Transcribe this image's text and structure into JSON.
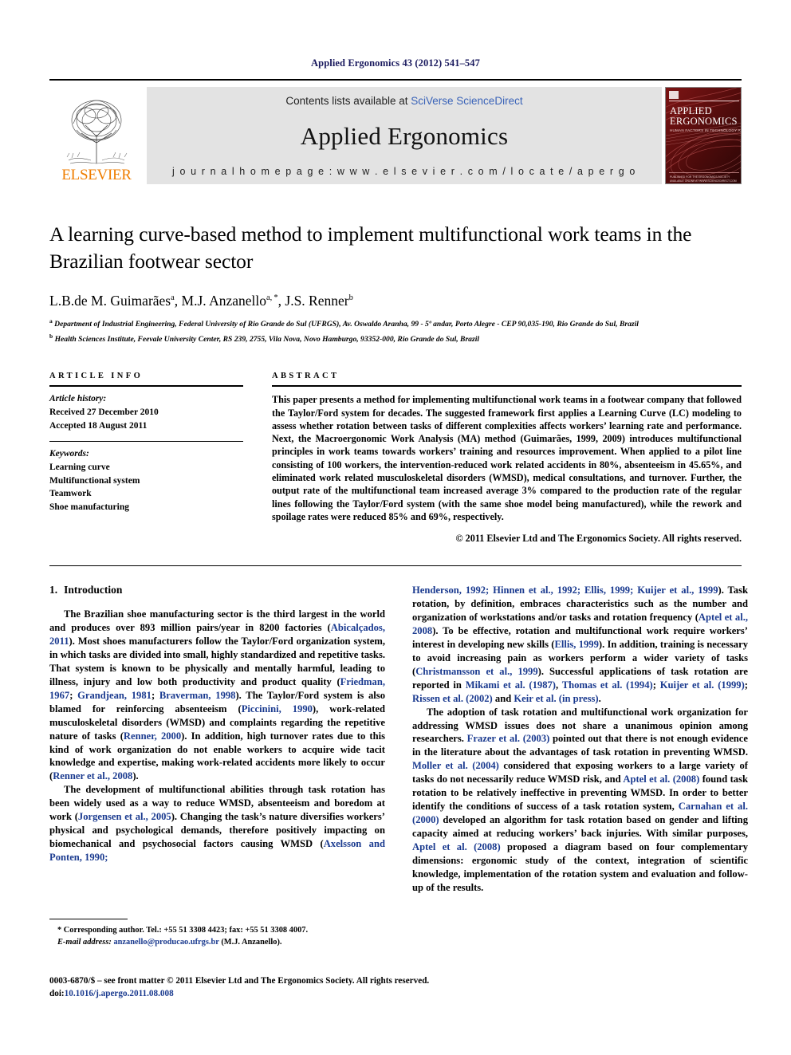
{
  "running_head": "Applied Ergonomics 43 (2012) 541–547",
  "masthead": {
    "publisher_logo_text": "ELSEVIER",
    "contents_prefix": "Contents lists available at ",
    "contents_link": "SciVerse ScienceDirect",
    "journal_name": "Applied Ergonomics",
    "homepage_label": "j o u r n a l   h o m e p a g e :   w w w . e l s e v i e r . c o m / l o c a t e / a p e r g o",
    "cover": {
      "line1": "APPLIED",
      "line2": "ERGONOMICS",
      "line3": "HUMAN FACTORS IN TECHNOLOGY AND SOCIETY"
    }
  },
  "article": {
    "title": "A learning curve-based method to implement multifunctional work teams in the Brazilian footwear sector",
    "authors": "L.B.de M. Guimarães<sup>a</sup>, M.J. Anzanello<sup>a, *</sup>, J.S. Renner<sup>b</sup>",
    "affiliation_a": "<sup>a</sup> Department of Industrial Engineering, Federal University of Rio Grande do Sul (UFRGS), Av. Oswaldo Aranha, 99 - 5º andar, Porto Alegre - CEP 90,035-190, Rio Grande do Sul, Brazil",
    "affiliation_b": "<sup>b</sup> Health Sciences Institute, Feevale University Center, RS 239, 2755, Vila Nova, Novo Hamburgo, 93352-000, Rio Grande do Sul, Brazil"
  },
  "info": {
    "heading": "ARTICLE INFO",
    "history_label": "Article history:",
    "history_lines": [
      "Received 27 December 2010",
      "Accepted 18 August 2011"
    ],
    "keywords_label": "Keywords:",
    "keywords": [
      "Learning curve",
      "Multifunctional system",
      "Teamwork",
      "Shoe manufacturing"
    ]
  },
  "abstract": {
    "heading": "ABSTRACT",
    "text": "This paper presents a method for implementing multifunctional work teams in a footwear company that followed the Taylor/Ford system for decades. The suggested framework first applies a Learning Curve (LC) modeling to assess whether rotation between tasks of different complexities affects workers’ learning rate and performance. Next, the Macroergonomic Work Analysis (MA) method (Guimarães, 1999, 2009) introduces multifunctional principles in work teams towards workers’ training and resources improvement. When applied to a pilot line consisting of 100 workers, the intervention-reduced work related accidents in 80%, absenteeism in 45.65%, and eliminated work related musculoskeletal disorders (WMSD), medical consultations, and turnover. Further, the output rate of the multifunctional team increased average 3% compared to the production rate of the regular lines following the Taylor/Ford system (with the same shoe model being manufactured), while the rework and spoilage rates were reduced 85% and 69%, respectively.",
    "copyright": "© 2011 Elsevier Ltd and The Ergonomics Society. All rights reserved."
  },
  "body": {
    "section_number": "1.",
    "section_title": "Introduction",
    "left_paragraphs": [
      "The Brazilian shoe manufacturing sector is the third largest in the world and produces over 893 million pairs/year in 8200 factories (<a class=\"ref\" data-name=\"citation-link\" data-interactable=\"true\">Abicalçados, 2011</a>). Most shoes manufacturers follow the Taylor/Ford organization system, in which tasks are divided into small, highly standardized and repetitive tasks. That system is known to be physically and mentally harmful, leading to illness, injury and low both productivity and product quality (<a class=\"ref\" data-name=\"citation-link\" data-interactable=\"true\">Friedman, 1967</a>; <a class=\"ref\" data-name=\"citation-link\" data-interactable=\"true\">Grandjean, 1981</a>; <a class=\"ref\" data-name=\"citation-link\" data-interactable=\"true\">Braverman, 1998</a>). The Taylor/Ford system is also blamed for reinforcing absenteeism (<a class=\"ref\" data-name=\"citation-link\" data-interactable=\"true\">Piccinini, 1990</a>), work-related musculoskeletal disorders (WMSD) and complaints regarding the repetitive nature of tasks (<a class=\"ref\" data-name=\"citation-link\" data-interactable=\"true\">Renner, 2000</a>). In addition, high turnover rates due to this kind of work organization do not enable workers to acquire wide tacit knowledge and expertise, making work-related accidents more likely to occur (<a class=\"ref\" data-name=\"citation-link\" data-interactable=\"true\">Renner et al., 2008</a>).",
      "The development of multifunctional abilities through task rotation has been widely used as a way to reduce WMSD, absenteeism and boredom at work (<a class=\"ref\" data-name=\"citation-link\" data-interactable=\"true\">Jorgensen et al., 2005</a>). Changing the task’s nature diversifies workers’ physical and psychological demands, therefore positively impacting on biomechanical and psychosocial factors causing WMSD (<a class=\"ref\" data-name=\"citation-link\" data-interactable=\"true\">Axelsson and Ponten, 1990;</a>"
    ],
    "right_paragraphs": [
      "<a class=\"ref\" data-name=\"citation-link\" data-interactable=\"true\">Henderson, 1992; Hinnen et al., 1992; Ellis, 1999; Kuijer et al., 1999</a>). Task rotation, by definition, embraces characteristics such as the number and organization of workstations and/or tasks and rotation frequency (<a class=\"ref\" data-name=\"citation-link\" data-interactable=\"true\">Aptel et al., 2008</a>). To be effective, rotation and multifunctional work require workers’ interest in developing new skills (<a class=\"ref\" data-name=\"citation-link\" data-interactable=\"true\">Ellis, 1999</a>). In addition, training is necessary to avoid increasing pain as workers perform a wider variety of tasks (<a class=\"ref\" data-name=\"citation-link\" data-interactable=\"true\">Christmansson et al., 1999</a>). Successful applications of task rotation are reported in <a class=\"ref\" data-name=\"citation-link\" data-interactable=\"true\">Mikami et al. (1987)</a>, <a class=\"ref\" data-name=\"citation-link\" data-interactable=\"true\">Thomas et al. (1994)</a>; <a class=\"ref\" data-name=\"citation-link\" data-interactable=\"true\">Kuijer et al. (1999)</a>; <a class=\"ref\" data-name=\"citation-link\" data-interactable=\"true\">Rissen et al. (2002)</a> and <a class=\"ref\" data-name=\"citation-link\" data-interactable=\"true\">Keir et al. (in press)</a>.",
      "The adoption of task rotation and multifunctional work organization for addressing WMSD issues does not share a unanimous opinion among researchers. <a class=\"ref\" data-name=\"citation-link\" data-interactable=\"true\">Frazer et al. (2003)</a> pointed out that there is not enough evidence in the literature about the advantages of task rotation in preventing WMSD. <a class=\"ref\" data-name=\"citation-link\" data-interactable=\"true\">Moller et al. (2004)</a> considered that exposing workers to a large variety of tasks do not necessarily reduce WMSD risk, and <a class=\"ref\" data-name=\"citation-link\" data-interactable=\"true\">Aptel et al. (2008)</a> found task rotation to be relatively ineffective in preventing WMSD. In order to better identify the conditions of success of a task rotation system, <a class=\"ref\" data-name=\"citation-link\" data-interactable=\"true\">Carnahan et al. (2000)</a> developed an algorithm for task rotation based on gender and lifting capacity aimed at reducing workers’ back injuries. With similar purposes, <a class=\"ref\" data-name=\"citation-link\" data-interactable=\"true\">Aptel et al. (2008)</a> proposed a diagram based on four complementary dimensions: ergonomic study of the context, integration of scientific knowledge, implementation of the rotation system and evaluation and follow-up of the results."
    ]
  },
  "footnote": {
    "corresponding": "* Corresponding author. Tel.: +55 51 3308 4423; fax: +55 51 3308 4007.",
    "email_label": "E-mail address:",
    "email": "anzanello@producao.ufrgs.br",
    "email_owner": "(M.J. Anzanello)."
  },
  "footer": {
    "issn_line": "0003-6870/$ – see front matter © 2011 Elsevier Ltd and The Ergonomics Society. All rights reserved.",
    "doi_label": "doi:",
    "doi": "10.1016/j.apergo.2011.08.008"
  },
  "colors": {
    "link_blue": "#3a63b8",
    "citation_blue": "#1a3a8f",
    "running_head_navy": "#1a1a5e",
    "elsevier_orange": "#ef7d00",
    "band_gray": "#e3e3e3",
    "cover_red": "#6b0f0f"
  }
}
